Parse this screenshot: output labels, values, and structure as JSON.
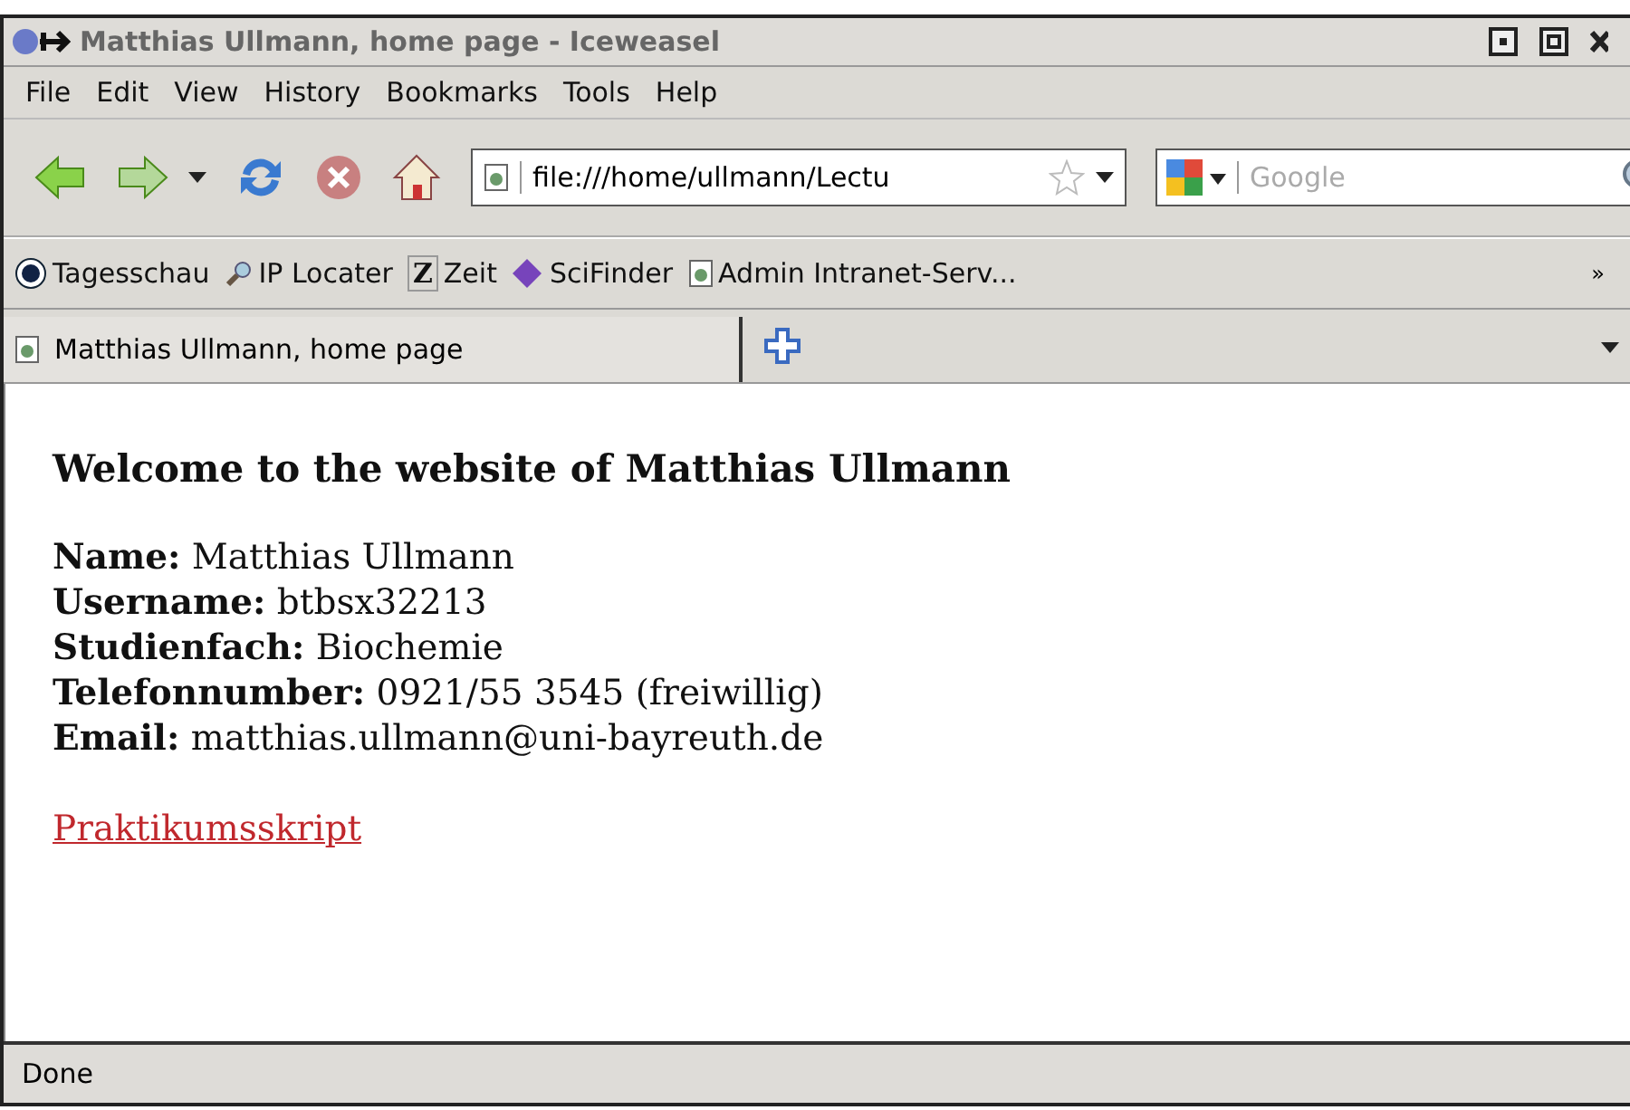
{
  "window": {
    "title": "Matthias Ullmann, home page - Iceweasel"
  },
  "menu": [
    "File",
    "Edit",
    "View",
    "History",
    "Bookmarks",
    "Tools",
    "Help"
  ],
  "address_bar": {
    "value": "file:///home/ullmann/Lectu",
    "bookmarked": false
  },
  "search": {
    "placeholder": "Google"
  },
  "bookmarks": [
    {
      "label": "Tagesschau",
      "kind": "circle"
    },
    {
      "label": "IP Locater",
      "kind": "magnifier"
    },
    {
      "label": "Zeit",
      "kind": "letter",
      "glyph": "Z"
    },
    {
      "label": "SciFinder",
      "kind": "diamond"
    },
    {
      "label": "Admin Intranet-Serv...",
      "kind": "page"
    }
  ],
  "bookmarks_overflow": "»",
  "tabs": [
    {
      "label": "Matthias Ullmann, home page",
      "selected": true
    }
  ],
  "page": {
    "heading": "Welcome to the website of Matthias Ullmann",
    "fields": [
      {
        "label": "Name:",
        "value": "Matthias Ullmann"
      },
      {
        "label": "Username:",
        "value": "btbsx32213"
      },
      {
        "label": "Studienfach:",
        "value": "Biochemie"
      },
      {
        "label": "Telefonnumber:",
        "value": "0921/55 3545 (freiwillig)"
      },
      {
        "label": "Email:",
        "value": "matthias.ullmann@uni-bayreuth.de"
      }
    ],
    "link": "Praktikumsskript"
  },
  "status_bar": {
    "text": "Done"
  }
}
